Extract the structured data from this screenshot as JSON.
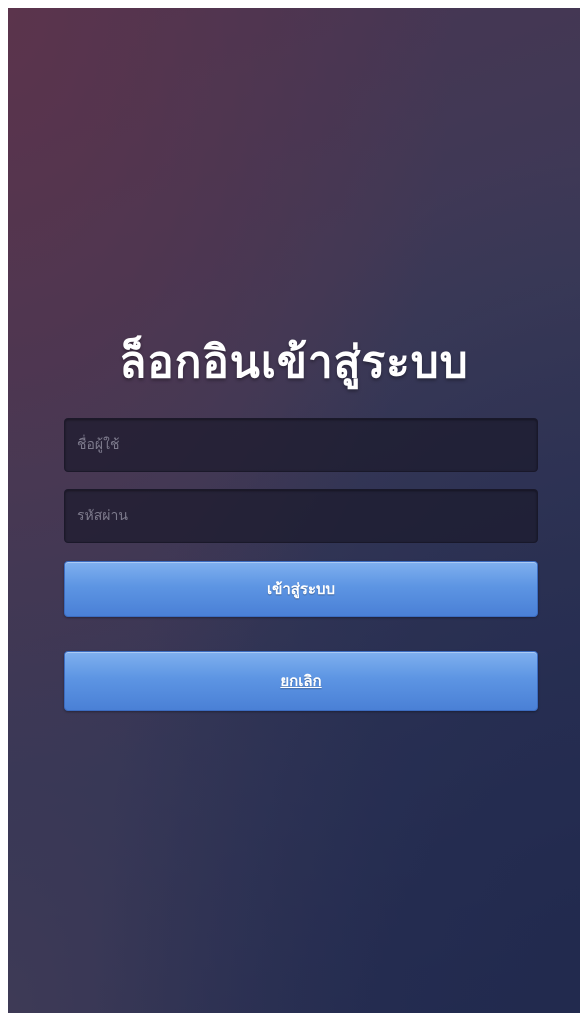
{
  "login": {
    "title": "ล็อกอินเข้าสู่ระบบ",
    "username_placeholder": "ชื่อผู้ใช้",
    "username_value": "",
    "password_placeholder": "รหัสผ่าน",
    "password_value": "",
    "login_button_label": "เข้าสู่ระบบ",
    "cancel_button_label": "ยกเลิก"
  },
  "colors": {
    "background_top_left": "#5c344c",
    "background_bottom_right": "#222a4e",
    "field_background": "#1c1a2c",
    "button_gradient_top": "#7fb0ef",
    "button_gradient_bottom": "#4a80d6",
    "title_text": "#ffffff"
  }
}
